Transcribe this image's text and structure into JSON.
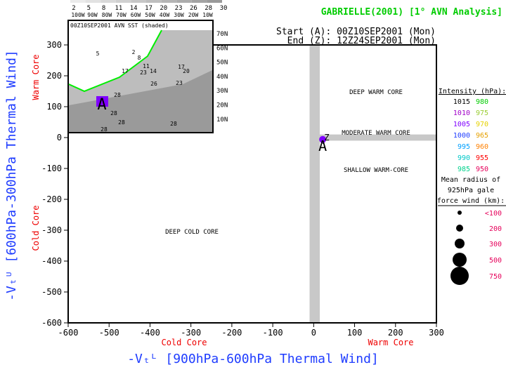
{
  "title": "GABRIELLE(2001) [1° AVN Analysis]",
  "start": "Start (A): 00Z10SEP2001 (Mon)",
  "end": "End (Z): 12Z24SEP2001 (Mon)",
  "colorbar": {
    "ticks": [
      "2",
      "5",
      "8",
      "11",
      "14",
      "17",
      "20",
      "23",
      "26",
      "28",
      "30"
    ],
    "lons": [
      "100W",
      "90W",
      "80W",
      "70W",
      "60W",
      "50W",
      "40W",
      "30W",
      "20W",
      "10W"
    ]
  },
  "inset": {
    "title": "00Z10SEP2001 AVN SST (shaded)",
    "lats": [
      "70N",
      "60N",
      "50N",
      "40N",
      "30N",
      "20N",
      "10N"
    ],
    "contour_labels": [
      "2",
      "5",
      "8",
      "11",
      "14",
      "17",
      "20",
      "23",
      "26",
      "28",
      "28",
      "28",
      "28",
      "28",
      "17",
      "23"
    ]
  },
  "chart_data": {
    "type": "scatter",
    "xlabel": "-Vₜᴸ [900hPa-600hPa Thermal Wind]",
    "ylabel": "-Vₜᵁ [600hPa-300hPa Thermal Wind]",
    "xlim": [
      -600,
      300
    ],
    "ylim": [
      -600,
      300
    ],
    "xticks": [
      "-600",
      "-500",
      "-400",
      "-300",
      "-200",
      "-100",
      "0",
      "100",
      "200",
      "300"
    ],
    "yticks": [
      "300",
      "200",
      "100",
      "0",
      "-100",
      "-200",
      "-300",
      "-400",
      "-500",
      "-600"
    ],
    "x_cold": "Cold Core",
    "x_warm": "Warm Core",
    "y_cold": "Cold Core",
    "y_warm": "Warm Core",
    "regions": [
      "DEEP WARM CORE",
      "MODERATE WARM CORE",
      "SHALLOW WARM-CORE",
      "DEEP COLD CORE"
    ],
    "track": [
      {
        "label": "A",
        "x": 22,
        "y": -20,
        "color": "#7f00ff"
      },
      {
        "label": "Z",
        "x": 32,
        "y": 0,
        "color": "#7f00ff"
      }
    ]
  },
  "legend": {
    "intensity_title": "Intensity (hPa):",
    "intensity": [
      [
        "1015",
        "#000000",
        "980",
        "#00cc00"
      ],
      [
        "1010",
        "#a000c8",
        "975",
        "#9acd32"
      ],
      [
        "1005",
        "#7f00ff",
        "970",
        "#e6d200"
      ],
      [
        "1000",
        "#1e3cff",
        "965",
        "#e6a000"
      ],
      [
        "995",
        "#00a0ff",
        "960",
        "#ff8000"
      ],
      [
        "990",
        "#00c8c8",
        "955",
        "#ff0000"
      ],
      [
        "985",
        "#00d28c",
        "950",
        "#e6005a"
      ]
    ],
    "radius_title": [
      "Mean radius of",
      "925hPa gale",
      "force wind (km):"
    ],
    "radius": [
      "<100",
      "200",
      "300",
      "500",
      "750"
    ]
  }
}
